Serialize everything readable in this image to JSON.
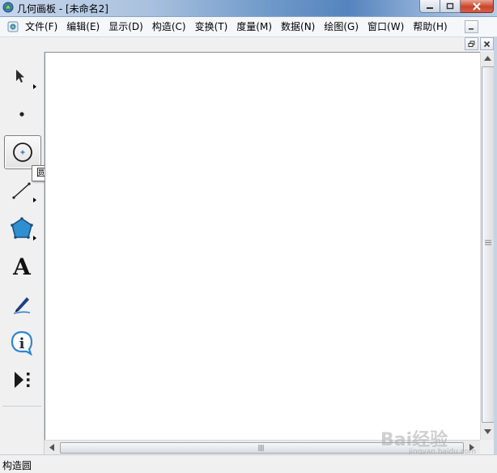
{
  "window": {
    "title": "几何画板 - [未命名2]"
  },
  "menubar": {
    "items": [
      {
        "label": "文件(F)"
      },
      {
        "label": "编辑(E)"
      },
      {
        "label": "显示(D)"
      },
      {
        "label": "构造(C)"
      },
      {
        "label": "变换(T)"
      },
      {
        "label": "度量(M)"
      },
      {
        "label": "数据(N)"
      },
      {
        "label": "绘图(G)"
      },
      {
        "label": "窗口(W)"
      },
      {
        "label": "帮助(H)"
      }
    ]
  },
  "toolbar": {
    "tools": [
      {
        "name": "arrow-tool",
        "icon": "arrow-select-icon"
      },
      {
        "name": "point-tool",
        "icon": "point-icon"
      },
      {
        "name": "compass-tool",
        "icon": "circle-compass-icon",
        "selected": true
      },
      {
        "name": "straightedge-tool",
        "icon": "line-segment-icon"
      },
      {
        "name": "polygon-tool",
        "icon": "pentagon-icon"
      },
      {
        "name": "text-tool",
        "icon": "letter-a-icon",
        "glyph": "A"
      },
      {
        "name": "marker-tool",
        "icon": "pen-marker-icon"
      },
      {
        "name": "information-tool",
        "icon": "info-icon",
        "glyph": "i"
      },
      {
        "name": "custom-tool",
        "icon": "play-more-icon"
      }
    ],
    "tooltip": "圆工具"
  },
  "statusbar": {
    "text": "构造圆"
  },
  "watermark": {
    "brand": "Bai",
    "brand_cn": "经验",
    "url": "jingyan.baidu.com"
  },
  "colors": {
    "title_gradient_mid": "#6d98c9",
    "polygon_fill": "#2f8fd0",
    "canvas_bg": "#ffffff",
    "chrome_bg": "#f0f0f0"
  }
}
